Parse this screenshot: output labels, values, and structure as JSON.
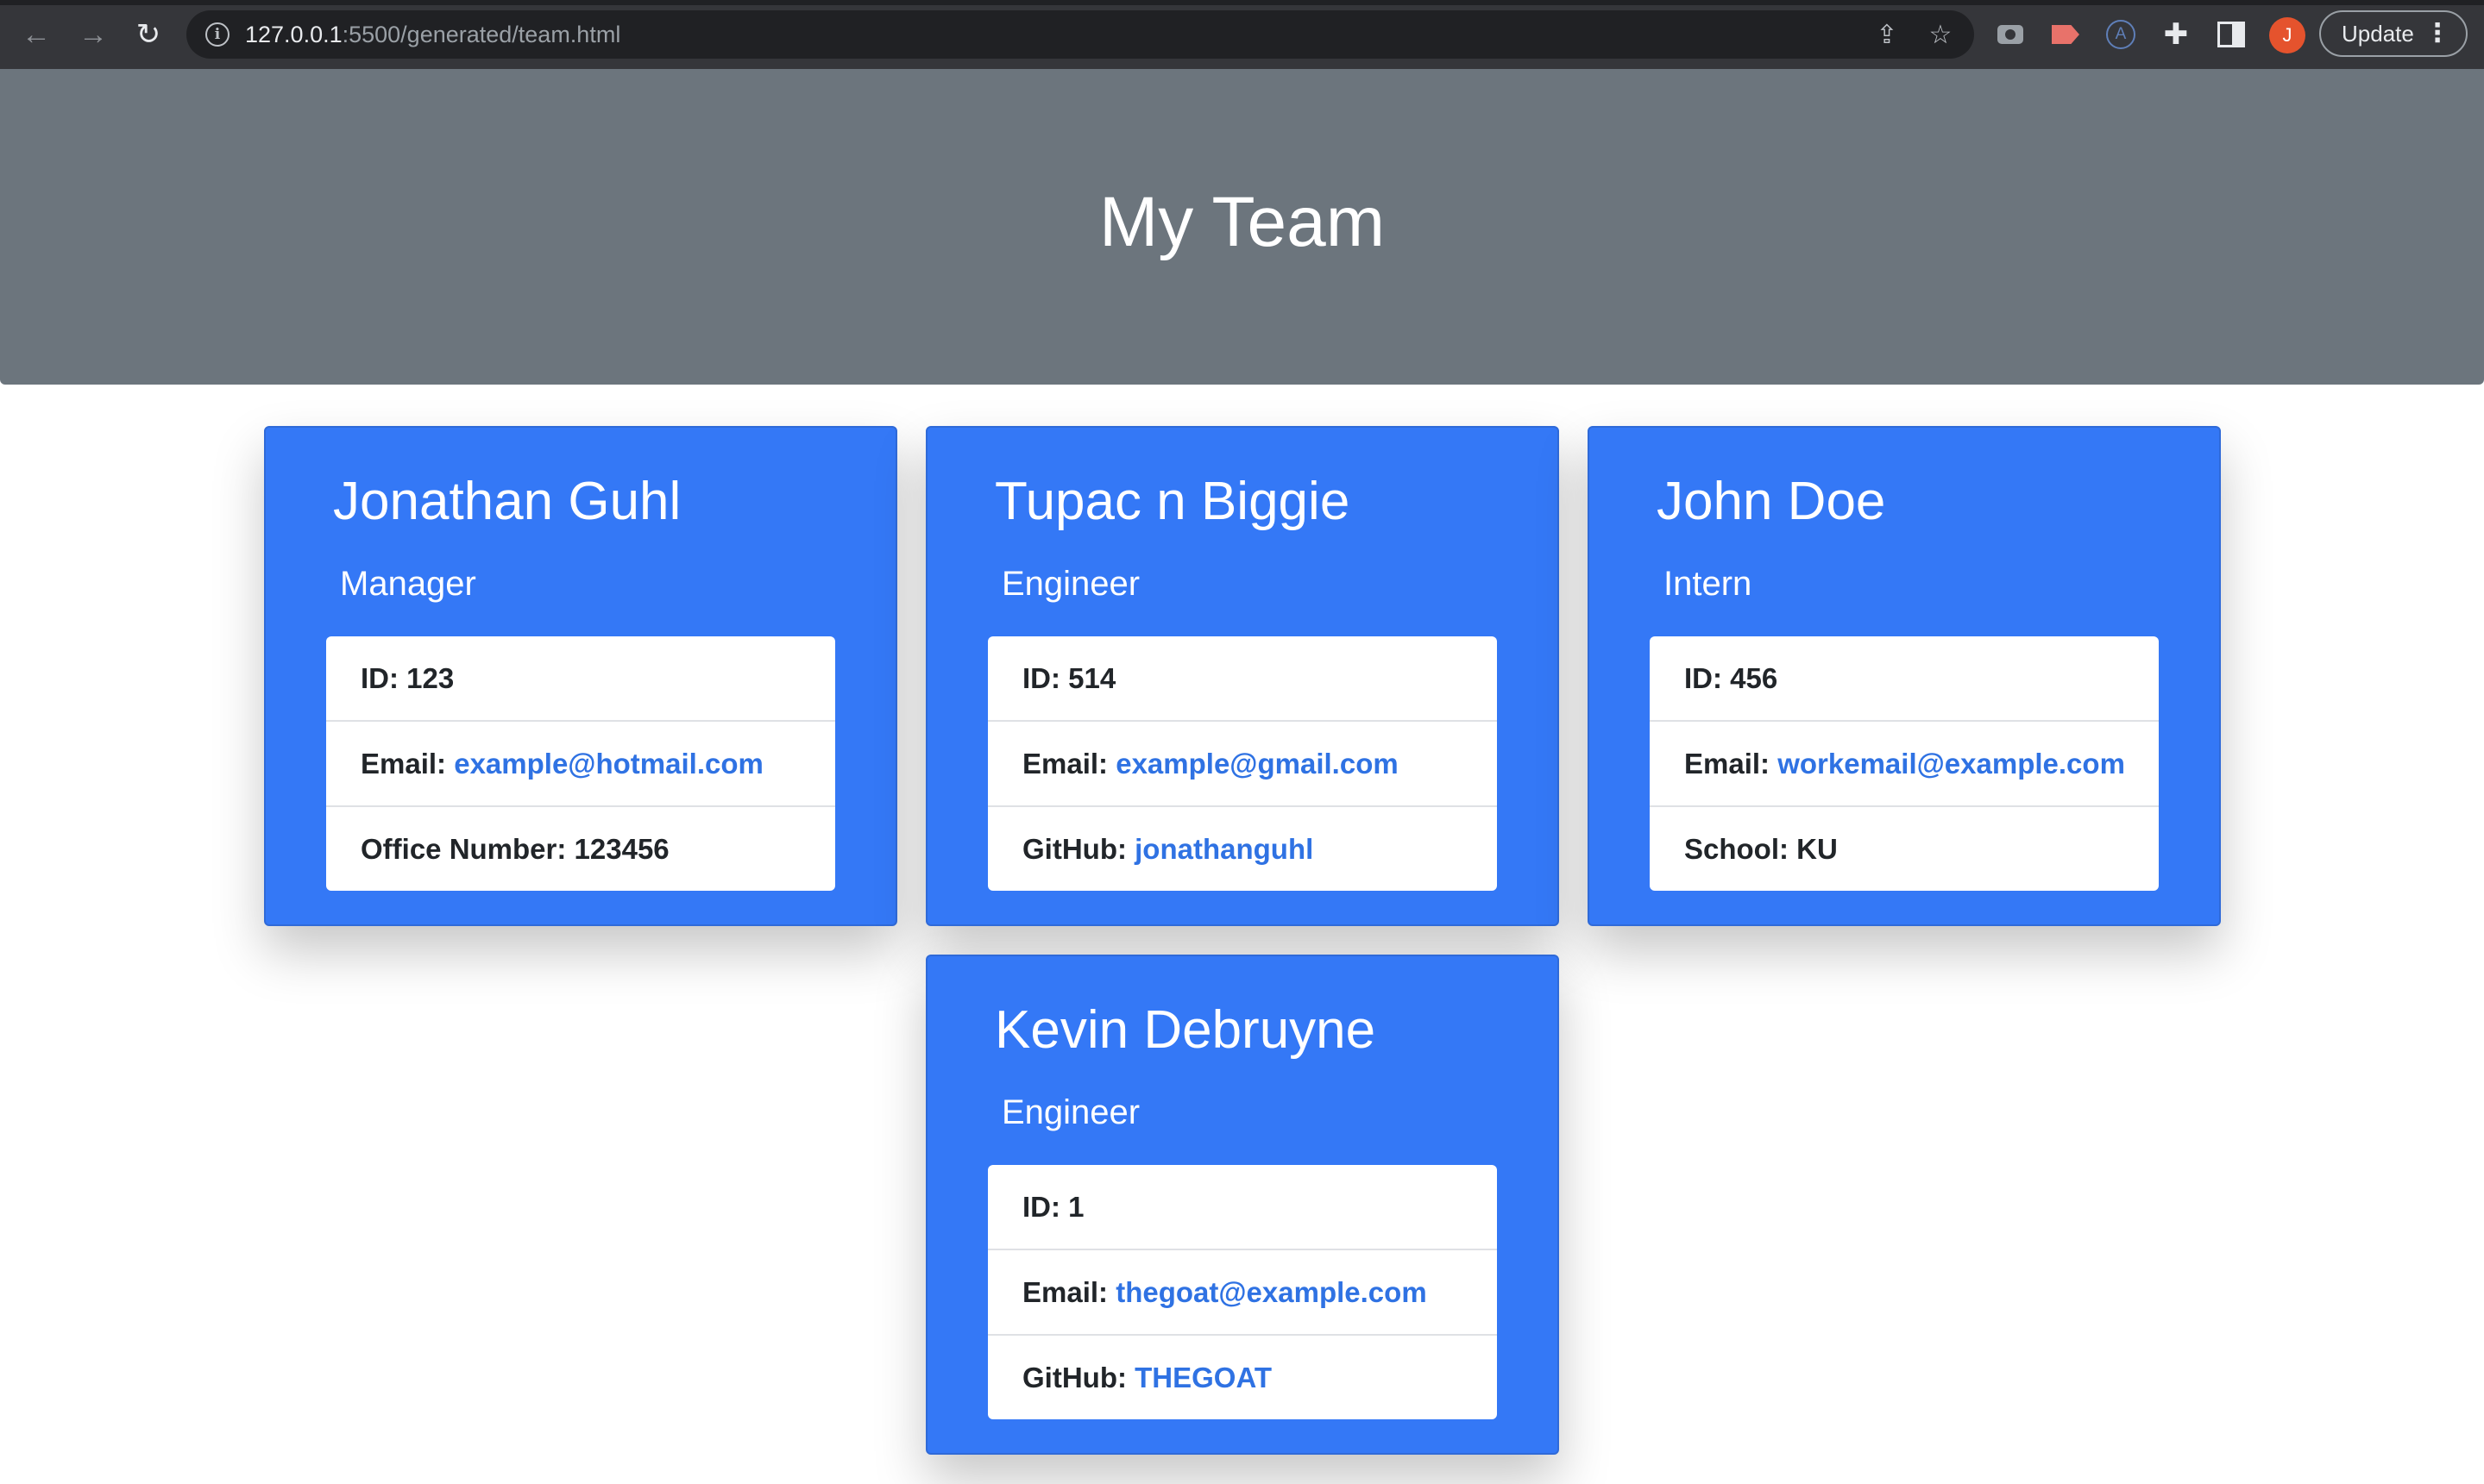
{
  "browser": {
    "url_host": "127.0.0.1",
    "url_path": ":5500/generated/team.html",
    "profile_initial": "J",
    "update_label": "Update",
    "menu_glyph": "⋮"
  },
  "page": {
    "title": "My Team"
  },
  "colors": {
    "header_bg": "#6c757d",
    "card_bg": "#3478f6",
    "link": "#2f72e3"
  },
  "team": [
    {
      "name": "Jonathan Guhl",
      "role": "Manager",
      "id_label": "ID:",
      "id": "123",
      "email_label": "Email:",
      "email": "example@hotmail.com",
      "extra_label": "Office Number:",
      "extra_value": "123456"
    },
    {
      "name": "Tupac n Biggie",
      "role": "Engineer",
      "id_label": "ID:",
      "id": "514",
      "email_label": "Email:",
      "email": "example@gmail.com",
      "extra_label": "GitHub:",
      "extra_value": "jonathanguhl"
    },
    {
      "name": "John Doe",
      "role": "Intern",
      "id_label": "ID:",
      "id": "456",
      "email_label": "Email:",
      "email": "workemail@example.com",
      "extra_label": "School:",
      "extra_value": "KU"
    },
    {
      "name": "Kevin Debruyne",
      "role": "Engineer",
      "id_label": "ID:",
      "id": "1",
      "email_label": "Email:",
      "email": "thegoat@example.com",
      "extra_label": "GitHub:",
      "extra_value": "THEGOAT"
    }
  ]
}
